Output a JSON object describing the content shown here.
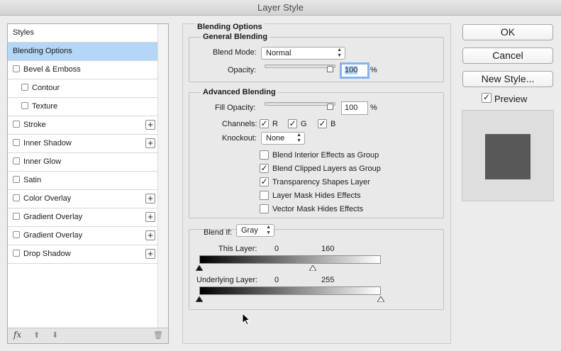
{
  "window": {
    "title": "Layer Style"
  },
  "styles_list": {
    "header": "Styles",
    "items": [
      {
        "label": "Blending Options",
        "selected": true,
        "checkbox": false,
        "plus": false,
        "sub": false
      },
      {
        "label": "Bevel & Emboss",
        "checkbox": true,
        "plus": false,
        "sub": false
      },
      {
        "label": "Contour",
        "checkbox": true,
        "plus": false,
        "sub": true
      },
      {
        "label": "Texture",
        "checkbox": true,
        "plus": false,
        "sub": true
      },
      {
        "label": "Stroke",
        "checkbox": true,
        "plus": true,
        "sub": false
      },
      {
        "label": "Inner Shadow",
        "checkbox": true,
        "plus": true,
        "sub": false
      },
      {
        "label": "Inner Glow",
        "checkbox": true,
        "plus": false,
        "sub": false
      },
      {
        "label": "Satin",
        "checkbox": true,
        "plus": false,
        "sub": false
      },
      {
        "label": "Color Overlay",
        "checkbox": true,
        "plus": true,
        "sub": false
      },
      {
        "label": "Gradient Overlay",
        "checkbox": true,
        "plus": true,
        "sub": false
      },
      {
        "label": "Gradient Overlay",
        "checkbox": true,
        "plus": true,
        "sub": false
      },
      {
        "label": "Drop Shadow",
        "checkbox": true,
        "plus": true,
        "sub": false
      }
    ],
    "footer": {
      "fx": "fx",
      "up": "⬆",
      "down": "⬇",
      "trash": "🗑"
    }
  },
  "blending_options": {
    "title": "Blending Options",
    "general": {
      "title": "General Blending",
      "blend_mode_label": "Blend Mode:",
      "blend_mode_value": "Normal",
      "opacity_label": "Opacity:",
      "opacity_value": "100",
      "opacity_unit": "%"
    },
    "advanced": {
      "title": "Advanced Blending",
      "fill_opacity_label": "Fill Opacity:",
      "fill_opacity_value": "100",
      "fill_opacity_unit": "%",
      "channels_label": "Channels:",
      "channels": [
        "R",
        "G",
        "B"
      ],
      "knockout_label": "Knockout:",
      "knockout_value": "None",
      "options": [
        {
          "label": "Blend Interior Effects as Group",
          "checked": false
        },
        {
          "label": "Blend Clipped Layers as Group",
          "checked": true
        },
        {
          "label": "Transparency Shapes Layer",
          "checked": true
        },
        {
          "label": "Layer Mask Hides Effects",
          "checked": false
        },
        {
          "label": "Vector Mask Hides Effects",
          "checked": false
        }
      ]
    },
    "blend_if": {
      "label": "Blend If:",
      "value": "Gray",
      "this_layer_label": "This Layer:",
      "this_layer_low": "0",
      "this_layer_high": "160",
      "underlying_label": "Underlying Layer:",
      "underlying_low": "0",
      "underlying_high": "255"
    }
  },
  "buttons": {
    "ok": "OK",
    "cancel": "Cancel",
    "new_style": "New Style...",
    "preview": "Preview"
  },
  "colors": {
    "selection": "#b4d7f7",
    "preview_swatch": "#585858",
    "focus_ring": "#83b4ee"
  }
}
